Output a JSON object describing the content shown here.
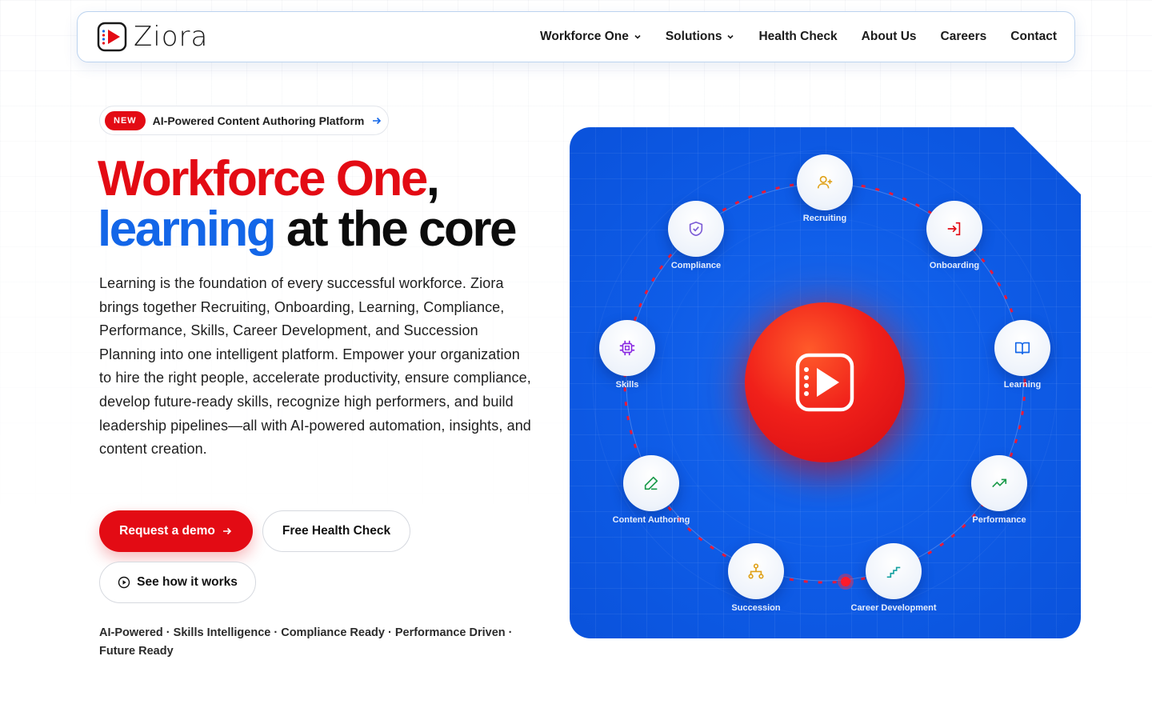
{
  "brand": {
    "name": "Ziora"
  },
  "nav": {
    "items": [
      {
        "label": "Workforce One",
        "dropdown": true
      },
      {
        "label": "Solutions",
        "dropdown": true
      },
      {
        "label": "Health Check",
        "dropdown": false
      },
      {
        "label": "About Us",
        "dropdown": false
      },
      {
        "label": "Careers",
        "dropdown": false
      },
      {
        "label": "Contact",
        "dropdown": false
      }
    ]
  },
  "hero": {
    "badge": {
      "tag": "NEW",
      "text": "AI-Powered Content Authoring Platform"
    },
    "headline": {
      "part1": "Workforce One",
      "comma": ",",
      "part2": "learning",
      "part3": " at the core"
    },
    "description": "Learning is the foundation of every successful workforce. Ziora brings together Recruiting, Onboarding, Learning, Compliance, Performance, Skills, Career Development, and Succession Planning into one intelligent platform. Empower your organization to hire the right people, accelerate productivity, ensure compliance, develop future-ready skills, recognize high performers, and build leadership pipelines—all with AI-powered automation, insights, and content creation.",
    "buttons": {
      "primary": "Request a demo",
      "secondary": "Free Health Check",
      "tertiary": "See how it works"
    },
    "tags": "AI-Powered · Skills Intelligence · Compliance Ready · Performance Driven · Future Ready"
  },
  "orbit": {
    "nodes": [
      {
        "label": "Recruiting",
        "icon": "user-plus-icon",
        "color": "#e0a21a"
      },
      {
        "label": "Onboarding",
        "icon": "login-icon",
        "color": "#e30b14"
      },
      {
        "label": "Learning",
        "icon": "book-icon",
        "color": "#1366e8"
      },
      {
        "label": "Performance",
        "icon": "trending-up-icon",
        "color": "#1a9a4a"
      },
      {
        "label": "Career Development",
        "icon": "stairs-icon",
        "color": "#14a0a0"
      },
      {
        "label": "Succession",
        "icon": "hierarchy-icon",
        "color": "#e0a21a"
      },
      {
        "label": "Content Authoring",
        "icon": "pen-icon",
        "color": "#1a9a4a"
      },
      {
        "label": "Skills",
        "icon": "chip-icon",
        "color": "#8a2be2"
      },
      {
        "label": "Compliance",
        "icon": "shield-check-icon",
        "color": "#7b5bd6"
      }
    ]
  },
  "colors": {
    "accent_red": "#e30b14",
    "accent_blue": "#1366e8"
  }
}
